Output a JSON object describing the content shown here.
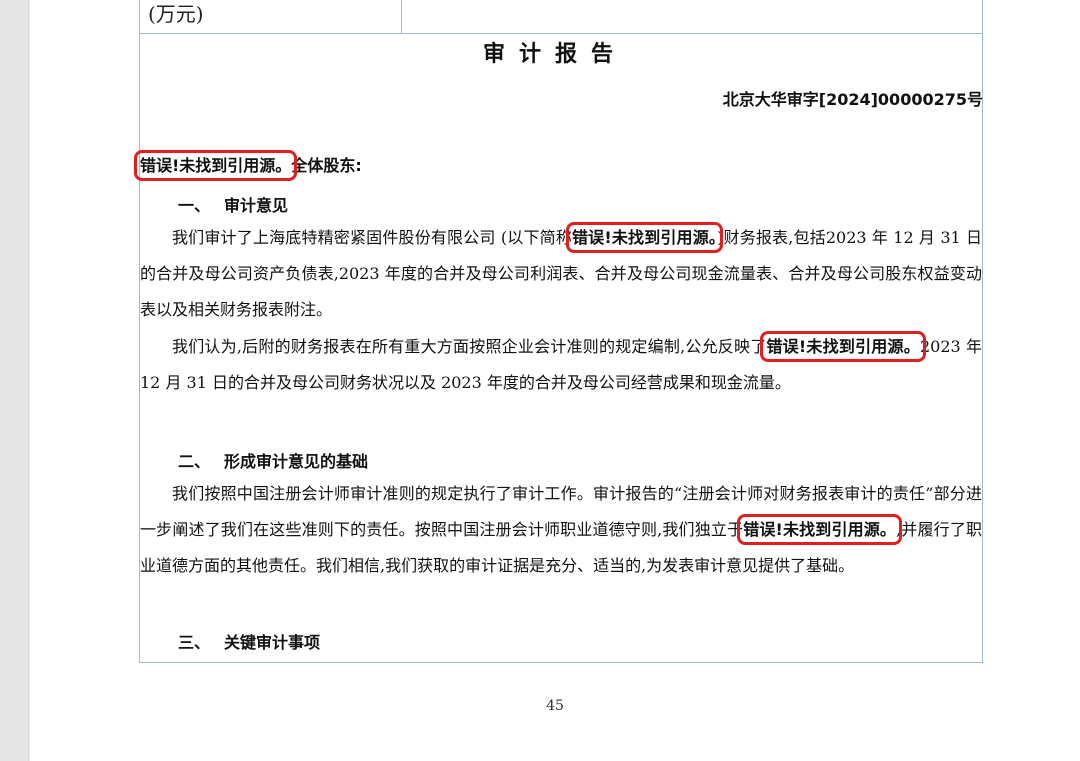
{
  "previous_table": {
    "cell_text": "(万元)"
  },
  "report": {
    "title": "审计报告",
    "reference_no": "北京大华审字[2024]00000275号",
    "addressee_error": "错误!未找到引用源。",
    "addressee": "全体股东:",
    "section1": {
      "number": "一、",
      "heading": "审计意见",
      "p1_a": "我们审计了上海底特精密紧固件股份有限公司 (以下简称",
      "p1_err": "错误!未找到引用源。",
      "p1_b": ")财务报表,包括2023 年 12 月 31 日的合并及母公司资产负债表,2023 年度的合并及母公司利润表、合并及母公司现金流量表、合并及母公司股东权益变动表以及相关财务报表附注。",
      "p2_a": "我们认为,后附的财务报表在所有重大方面按照企业会计准则的规定编制,公允反映了",
      "p2_err": "错误!未找到引用源。",
      "p2_b": "2023 年 12 月 31 日的合并及母公司财务状况以及 2023 年度的合并及母公司经营成果和现金流量。"
    },
    "section2": {
      "number": "二、",
      "heading": "形成审计意见的基础",
      "p1_a": "我们按照中国注册会计师审计准则的规定执行了审计工作。审计报告的“注册会计师对财务报表审计的责任”部分进一步阐述了我们在这些准则下的责任。按照中国注册会计师职业道德守则,我们独立于",
      "p1_err": "错误!未找到引用源。",
      "p1_b": ",并履行了职业道德方面的其他责任。我们相信,我们获取的审计证据是充分、适当的,为发表审计意见提供了基础。"
    },
    "section3": {
      "number": "三、",
      "heading": "关键审计事项"
    },
    "page_number": "45"
  }
}
